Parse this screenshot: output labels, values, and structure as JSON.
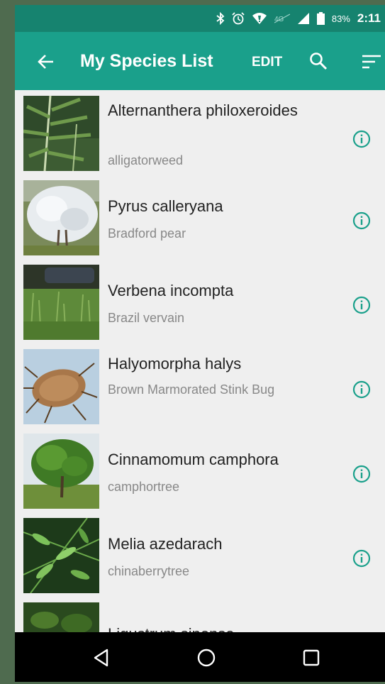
{
  "status": {
    "battery": "83%",
    "time": "2:11"
  },
  "appbar": {
    "title": "My Species List",
    "edit_label": "EDIT"
  },
  "colors": {
    "status_bar": "#16836f",
    "app_bar": "#1aa08b",
    "accent": "#1aa08b"
  },
  "species": [
    {
      "scientific": "Alternanthera philoxeroides",
      "common": "alligatorweed"
    },
    {
      "scientific": "Pyrus calleryana",
      "common": "Bradford pear"
    },
    {
      "scientific": "Verbena incompta",
      "common": "Brazil vervain"
    },
    {
      "scientific": "Halyomorpha halys",
      "common": "Brown Marmorated Stink Bug"
    },
    {
      "scientific": "Cinnamomum camphora",
      "common": "camphortree"
    },
    {
      "scientific": "Melia azedarach",
      "common": "chinaberrytree"
    },
    {
      "scientific": "Ligustrum sinense",
      "common": ""
    }
  ],
  "icons": {
    "status": [
      "bluetooth-icon",
      "alarm-icon",
      "wifi-icon",
      "no-data-icon",
      "signal-icon",
      "battery-icon"
    ],
    "appbar": [
      "back-arrow-icon",
      "search-icon",
      "sort-icon"
    ],
    "row": "info-icon",
    "nav": [
      "back-triangle-icon",
      "home-circle-icon",
      "recents-square-icon"
    ]
  }
}
